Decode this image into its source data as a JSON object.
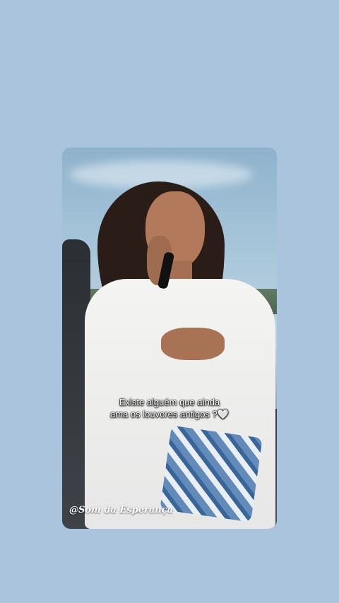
{
  "background_color": "#a9c4dc",
  "media": {
    "description_icon": "video-still",
    "caption_line1": "Existe alguém que ainda",
    "caption_line2": "ama os louvores antigos ?🤍",
    "watermark": "@Som da Esperança"
  }
}
